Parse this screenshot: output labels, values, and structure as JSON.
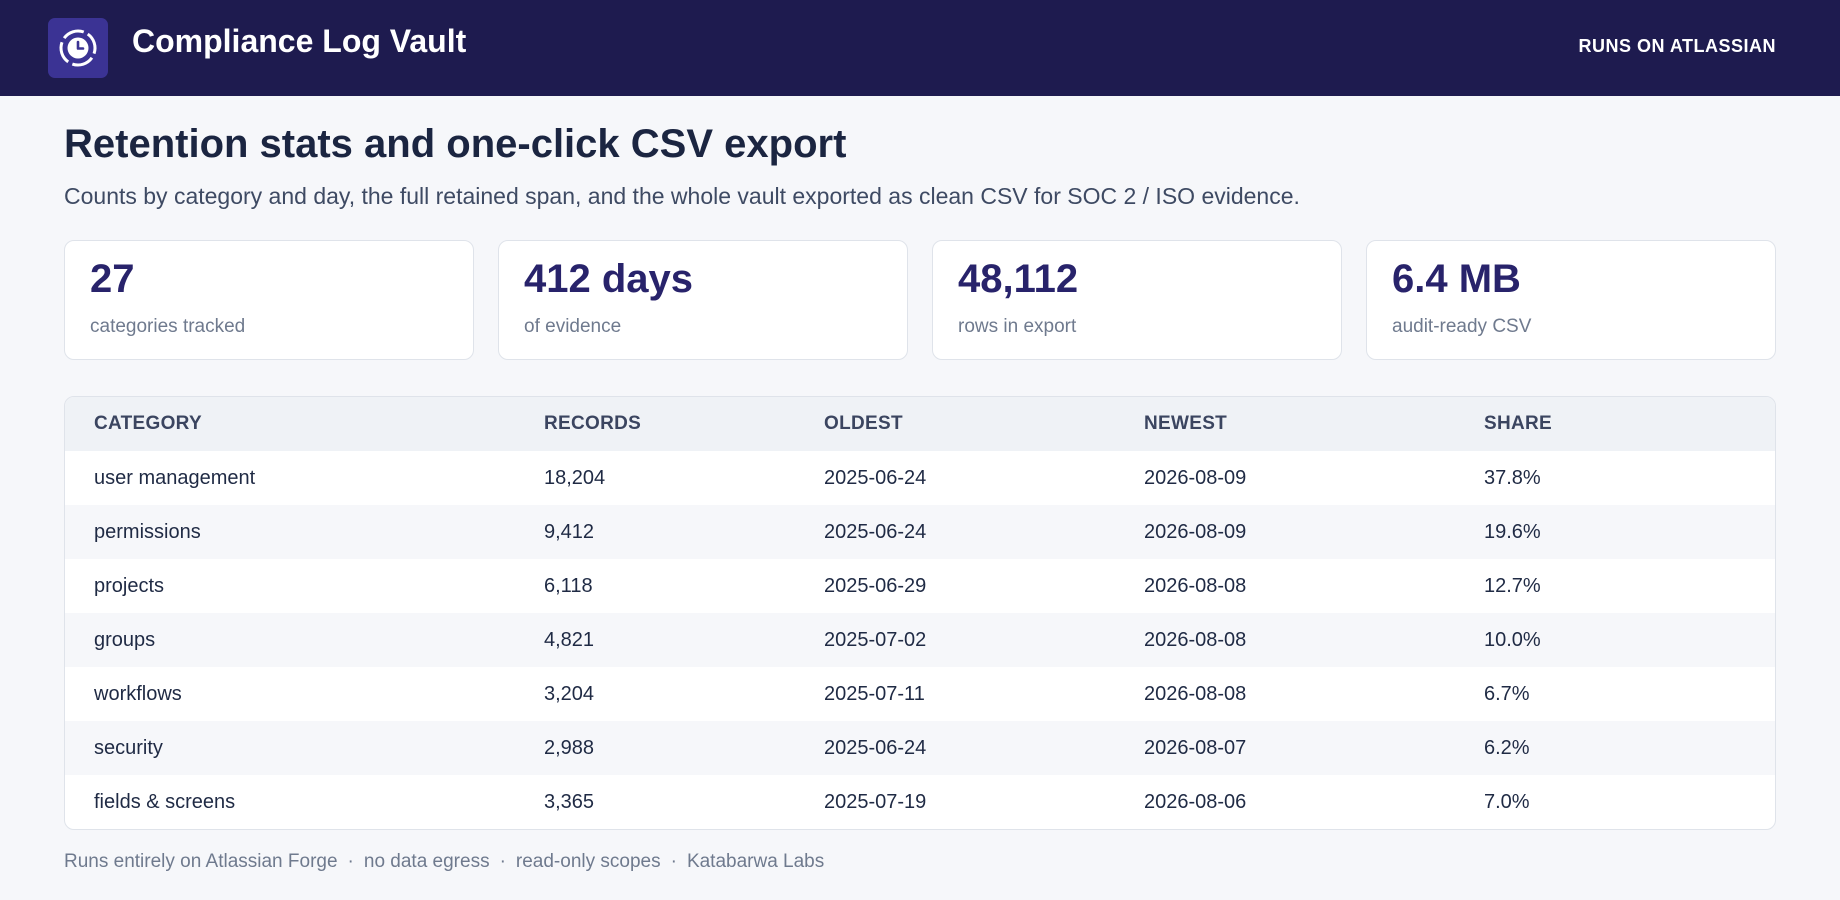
{
  "header": {
    "title": "Compliance Log Vault",
    "runs_on": "RUNS ON ATLASSIAN",
    "logo_icon": "clock-vault-icon",
    "colors": {
      "bar": "#1e1b4f",
      "logo_bg": "#3b3394"
    }
  },
  "page": {
    "heading": "Retention stats and one-click CSV export",
    "subtitle": "Counts by category and day, the full retained span, and the whole vault exported as clean CSV for SOC 2 / ISO evidence."
  },
  "stats": [
    {
      "value": "27",
      "label": "categories tracked"
    },
    {
      "value": "412 days",
      "label": "of evidence"
    },
    {
      "value": "48,112",
      "label": "rows in export"
    },
    {
      "value": "6.4 MB",
      "label": "audit-ready CSV"
    }
  ],
  "table": {
    "columns": [
      "CATEGORY",
      "RECORDS",
      "OLDEST",
      "NEWEST",
      "SHARE"
    ],
    "rows": [
      [
        "user management",
        "18,204",
        "2025-06-24",
        "2026-08-09",
        "37.8%"
      ],
      [
        "permissions",
        "9,412",
        "2025-06-24",
        "2026-08-09",
        "19.6%"
      ],
      [
        "projects",
        "6,118",
        "2025-06-29",
        "2026-08-08",
        "12.7%"
      ],
      [
        "groups",
        "4,821",
        "2025-07-02",
        "2026-08-08",
        "10.0%"
      ],
      [
        "workflows",
        "3,204",
        "2025-07-11",
        "2026-08-08",
        "6.7%"
      ],
      [
        "security",
        "2,988",
        "2025-06-24",
        "2026-08-07",
        "6.2%"
      ],
      [
        "fields & screens",
        "3,365",
        "2025-07-19",
        "2026-08-06",
        "7.0%"
      ]
    ]
  },
  "footer": {
    "items": [
      "Runs entirely on Atlassian Forge",
      "no data egress",
      "read-only scopes",
      "Katabarwa Labs"
    ],
    "separator": "·"
  }
}
